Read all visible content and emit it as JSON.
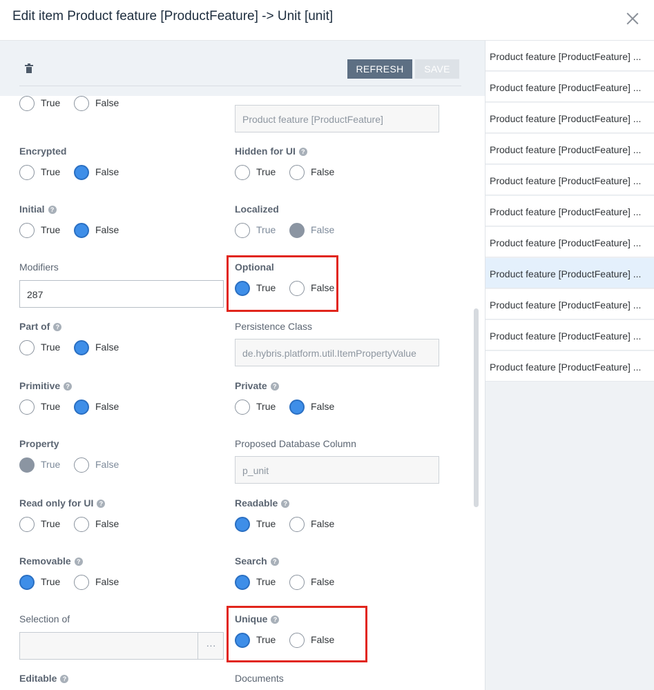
{
  "dialog": {
    "title": "Edit item Product feature [ProductFeature] -> Unit [unit]"
  },
  "toolbar": {
    "refresh_label": "REFRESH",
    "save_label": "SAVE"
  },
  "form": {
    "top_left": {
      "true": "True",
      "false": "False",
      "selected": "none"
    },
    "enclosing_type": {
      "value": "Product feature [ProductFeature]"
    },
    "encrypted": {
      "label": "Encrypted",
      "true": "True",
      "false": "False",
      "selected": "false"
    },
    "hidden_for_ui": {
      "label": "Hidden for UI",
      "true": "True",
      "false": "False",
      "selected": "none"
    },
    "initial": {
      "label": "Initial",
      "true": "True",
      "false": "False",
      "selected": "false"
    },
    "localized": {
      "label": "Localized",
      "true": "True",
      "false": "False",
      "selected": "false",
      "disabled": true
    },
    "modifiers": {
      "label": "Modifiers",
      "value": "287"
    },
    "optional": {
      "label": "Optional",
      "true": "True",
      "false": "False",
      "selected": "true"
    },
    "part_of": {
      "label": "Part of",
      "true": "True",
      "false": "False",
      "selected": "false"
    },
    "persistence_class": {
      "label": "Persistence Class",
      "value": "de.hybris.platform.util.ItemPropertyValue"
    },
    "primitive": {
      "label": "Primitive",
      "true": "True",
      "false": "False",
      "selected": "false"
    },
    "private": {
      "label": "Private",
      "true": "True",
      "false": "False",
      "selected": "false"
    },
    "property": {
      "label": "Property",
      "true": "True",
      "false": "False",
      "selected": "true",
      "disabled": true
    },
    "proposed_db_column": {
      "label": "Proposed Database Column",
      "value": "p_unit"
    },
    "read_only_for_ui": {
      "label": "Read only for UI",
      "true": "True",
      "false": "False",
      "selected": "none"
    },
    "readable": {
      "label": "Readable",
      "true": "True",
      "false": "False",
      "selected": "true"
    },
    "removable": {
      "label": "Removable",
      "true": "True",
      "false": "False",
      "selected": "true"
    },
    "search": {
      "label": "Search",
      "true": "True",
      "false": "False",
      "selected": "true"
    },
    "selection_of": {
      "label": "Selection of",
      "button": "···"
    },
    "unique": {
      "label": "Unique",
      "true": "True",
      "false": "False",
      "selected": "true"
    },
    "editable": {
      "label": "Editable"
    },
    "documents": {
      "label": "Documents"
    }
  },
  "sidebar": {
    "items": [
      "Product feature [ProductFeature] ...",
      "Product feature [ProductFeature] ...",
      "Product feature [ProductFeature] ...",
      "Product feature [ProductFeature] ...",
      "Product feature [ProductFeature] ...",
      "Product feature [ProductFeature] ...",
      "Product feature [ProductFeature] ...",
      "Product feature [ProductFeature] ...",
      "Product feature [ProductFeature] ...",
      "Product feature [ProductFeature] ...",
      "Product feature [ProductFeature] ..."
    ],
    "selected_index": 7
  },
  "colors": {
    "accent": "#3e8ee8",
    "highlight_box": "#e1261c",
    "refresh_button": "#5d6f83"
  }
}
